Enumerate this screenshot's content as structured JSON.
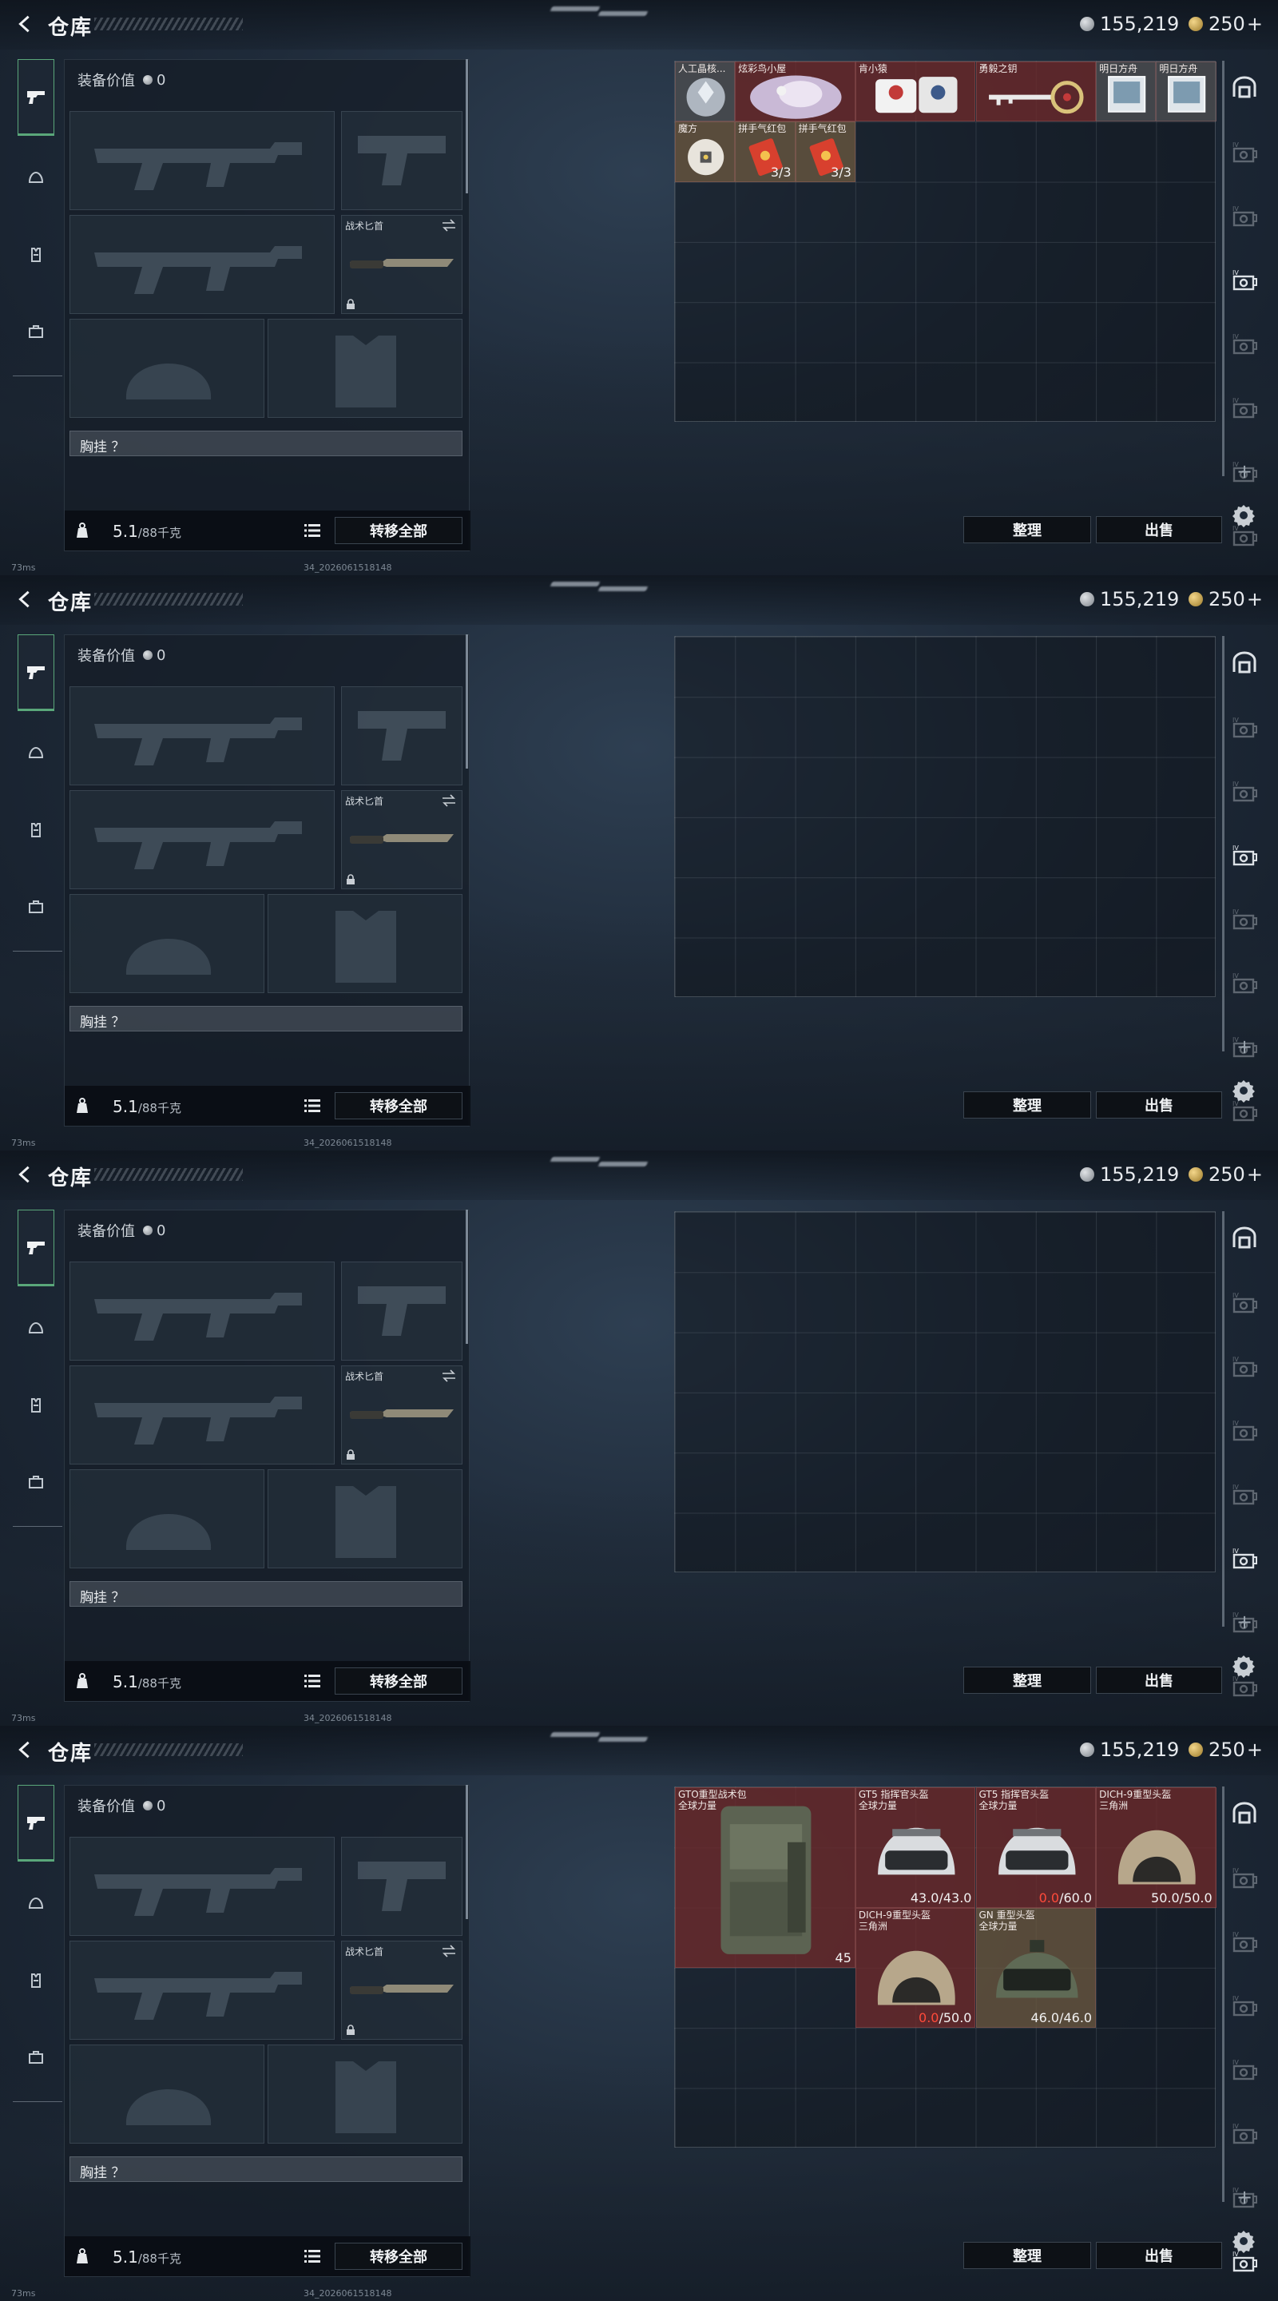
{
  "topbar": {
    "title": "仓库",
    "silver": "155,219",
    "gold": "250",
    "gold_plus": "+"
  },
  "left_panel": {
    "equip_value_label": "装备价值",
    "equip_value": "0",
    "knife_label": "战术匕首",
    "chest_label": "胸挂 ？",
    "weight": "5.1",
    "weight_cap": "/88千克",
    "transfer_label": "转移全部"
  },
  "actions": {
    "sort_label": "整理",
    "sell_label": "出售"
  },
  "status": {
    "ping": "73ms",
    "build": "34_2026061518148"
  },
  "frames": [
    {
      "items": [
        {
          "name": "人工晶核...",
          "stat": "",
          "art": "crystal",
          "bg": "grey"
        },
        {
          "name": "炫彩鸟小屋",
          "stat": "",
          "art": "bird",
          "bg": "red"
        },
        {
          "name": "肯小猿",
          "stat": "",
          "art": "toy",
          "bg": "red"
        },
        {
          "name": "勇毅之钥",
          "stat": "",
          "art": "key",
          "bg": "red"
        },
        {
          "name": "明日方舟",
          "stat": "",
          "art": "card",
          "bg": "grey"
        },
        {
          "name": "明日方舟",
          "stat": "",
          "art": "card",
          "bg": "grey"
        },
        {
          "name": "魔方",
          "stat": "",
          "art": "cube",
          "bg": "tan"
        },
        {
          "name": "拼手气红包",
          "stat": "3/3",
          "art": "envelope",
          "bg": "tan"
        },
        {
          "name": "拼手气红包",
          "stat": "3/3",
          "art": "envelope",
          "bg": "tan"
        }
      ],
      "sidebar_active": 3
    },
    {
      "items": [],
      "sidebar_active": 3
    },
    {
      "items": [],
      "sidebar_active": 5
    },
    {
      "items": [
        {
          "name": "GTO重型战术包\n全球力量",
          "stat": "45",
          "art": "backpack",
          "bg": "red"
        },
        {
          "name": "GT5 指挥官头盔\n全球力量",
          "stat": "43.0/43.0",
          "art": "helmet",
          "bg": "red"
        },
        {
          "name": "GT5 指挥官头盔\n全球力量",
          "stat_bad": "0.0",
          "stat": "/60.0",
          "art": "helmet",
          "bg": "red"
        },
        {
          "name": "DICH-9重型头盔\n三角洲",
          "stat": "50.0/50.0",
          "art": "helmet_tan",
          "bg": "red"
        },
        {
          "name": "DICH-9重型头盔\n三角洲",
          "stat_bad": "0.0",
          "stat": "/50.0",
          "art": "helmet_tan",
          "bg": "red"
        },
        {
          "name": "GN 重型头盔\n全球力量",
          "stat": "46.0/46.0",
          "art": "helmet_green",
          "bg": "tan"
        }
      ],
      "sidebar_active": 7
    }
  ],
  "colors": {
    "accent_green": "#5aa77a",
    "rarity_red": "#6e2a2c",
    "damage_red": "#ff4a3a"
  }
}
